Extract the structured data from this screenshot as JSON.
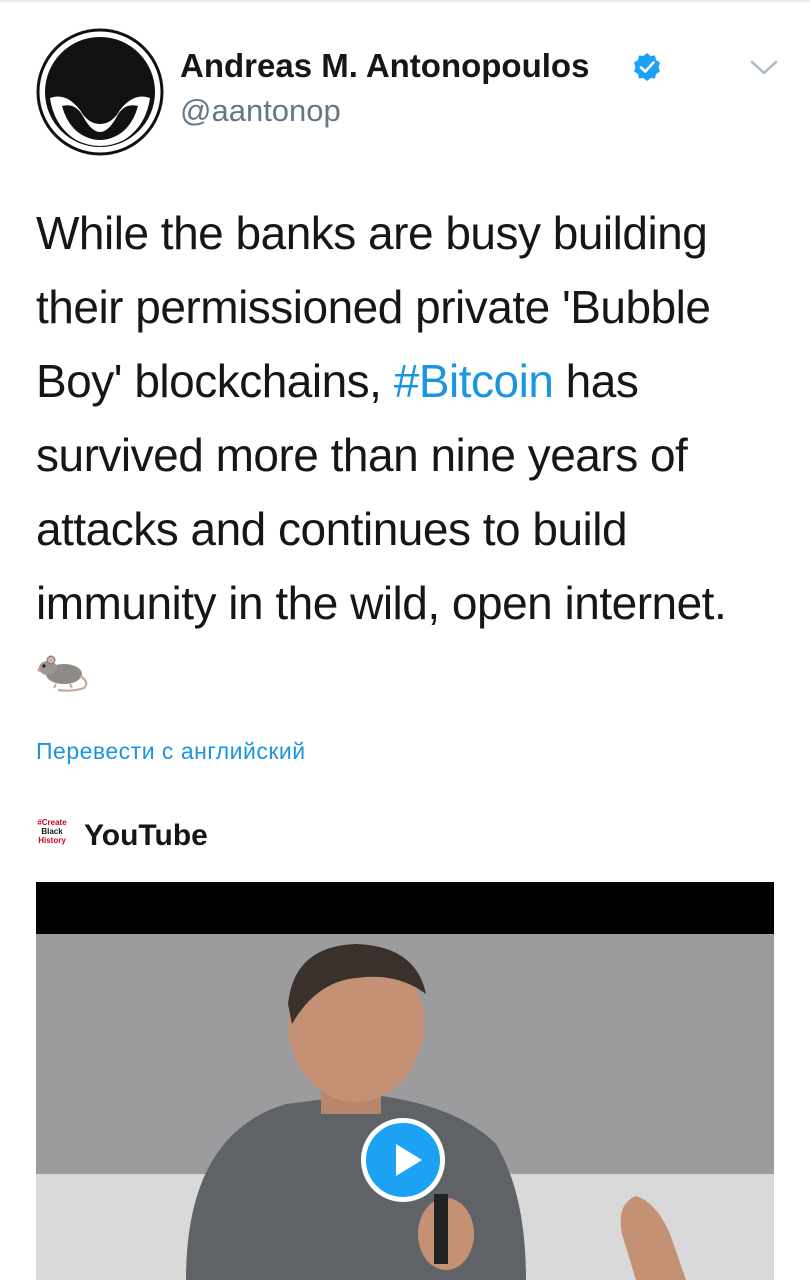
{
  "author": {
    "name": "Andreas M. Antonopoulos",
    "handle": "@aantonop",
    "avatar_icon": "masked-face-avatar",
    "verified_icon": "verified-badge-icon"
  },
  "tweet": {
    "text_before": "While the banks are busy building their permissioned private 'Bubble Boy' blockchains, ",
    "hashtag": "#Bitcoin",
    "text_after": " has survived more than nine years of attacks and continues to build immunity in the wild, open internet.",
    "emoji_icon": "rat-emoji",
    "translate_label": "Перевести с английский"
  },
  "card": {
    "logo_lines": [
      "#Create",
      "Black",
      "History"
    ],
    "source": "YouTube",
    "play_icon": "play-icon"
  },
  "colors": {
    "link": "#1b95e0",
    "handle": "#657786",
    "play": "#1da1f2"
  }
}
